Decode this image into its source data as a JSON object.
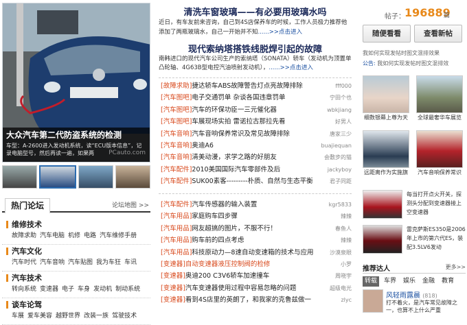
{
  "hero": {
    "title": "大众汽车第二代防盗系统的检测",
    "desc": "车型：A-2600进入发动机系统，读“ECU版本信息”，记录电脑型号，然后再读一遍，如果两",
    "watermark": "PCauto.com"
  },
  "forum": {
    "tab": "热门论坛",
    "more": "论坛地图 >>",
    "sections": [
      {
        "title": "维修技术",
        "links": [
          "故障求助",
          "汽车电脑",
          "机修",
          "电路",
          "汽车维修手册"
        ]
      },
      {
        "title": "汽车文化",
        "links": [
          "汽车时代",
          "汽车音响",
          "汽车贴图",
          "我为车狂",
          "车讯"
        ]
      },
      {
        "title": "汽车技术",
        "links": [
          "转向系统",
          "变速器",
          "电子",
          "车身",
          "发动机",
          "制动系统"
        ]
      },
      {
        "title": "谈车论驾",
        "links": [
          "车展",
          "爱车美容",
          "越野世界",
          "改装一族",
          "驾驶技术"
        ]
      }
    ]
  },
  "news1": {
    "title": "清洗车窗玻璃——有必要用玻璃水吗",
    "body": "近日，有车友前来咨询，自己到4S店保养车的时候，工作人员极力推荐他添加了两瓶玻璃水，自己一开始并不知",
    "more": "......>>点击进入"
  },
  "news2": {
    "title": "现代索纳塔搭铁线脱焊引起的故障",
    "body": "南韩进口的现代汽车公司生产的索纳塔（SONATA）轿车（发动机为顶置单凸轮轴、4G63B型电控汽油喷射发动机），",
    "more": "......>>点击进入"
  },
  "articles1": [
    {
      "cat": "[故障求助]",
      "title": "捷达轿车ABS故障警告灯点亮故障排除",
      "user": "fff000"
    },
    {
      "cat": "[汽车图吧]",
      "title": "电子交通罚单 杂谈各国违章罚单",
      "user": "宁田个也"
    },
    {
      "cat": "[汽车图吧]",
      "title": "汽车的环保功臣一三元催化器",
      "user": "wbkjiang"
    },
    {
      "cat": "[汽车图吧]",
      "title": "车展现场实拍 雷诺拉古那拉先看",
      "user": "好男人"
    },
    {
      "cat": "[汽车音响]",
      "title": "汽车音响保养常识及常见故障排除",
      "user": "唐家三少"
    },
    {
      "cat": "[汽车音响]",
      "title": "奥迪A6",
      "user": "buajiequan"
    },
    {
      "cat": "[汽车音响]",
      "title": "清美动漫，求学之路的好朋友",
      "user": "会敷步的猫"
    },
    {
      "cat": "[汽车配件]",
      "title": "2010美国国际汽车零部件及后",
      "user": "jackyboy"
    },
    {
      "cat": "[汽车配件]",
      "title": "SUK00素客---------朴质、自然与生态平衡",
      "user": "君子同距"
    }
  ],
  "articles2": [
    {
      "cat": "[汽车配件]",
      "title": "汽车传感器的输入装置",
      "user": "kgr5833"
    },
    {
      "cat": "[汽车用品]",
      "title": "家庭购车四步骤",
      "user": "辣辣"
    },
    {
      "cat": "[汽车用品]",
      "title": "网友超搞的图片，不服不行！",
      "user": "春鱼人"
    },
    {
      "cat": "[汽车用品]",
      "title": "购车前的四点考虑",
      "user": "辣辣"
    },
    {
      "cat": "[汽车用品]",
      "title": "科技原动力—8速自动变速箱的技术与应用",
      "user": "沙漠泉眼"
    },
    {
      "cat": "[变速器]",
      "title": "自动变速器液压控制阀的检修",
      "user": "小罗",
      "highlight": true
    },
    {
      "cat": "[变速器]",
      "title": "奥迪200 C3V6轿车加速撞车",
      "user": "周晓宇"
    },
    {
      "cat": "[变速器]",
      "title": "汽车变速器使用过程中容易忽略的问题",
      "user": "超级电光"
    },
    {
      "cat": "[变速器]",
      "title": "看到4S店里的英朗了，和我家的克鲁兹做一",
      "user": "zlyc"
    }
  ],
  "right": {
    "count_label": "帖子：",
    "count": "196889",
    "count_unit": "篇",
    "btn_random": "随便看看",
    "btn_new": "查看新帖",
    "notice1": "我如何实现发帖时图文混排效果",
    "notice_tag": "公告:",
    "notice2": "我如何实现发帖时图文混排效",
    "pics": [
      {
        "cap": "细数银幕上尊为天"
      },
      {
        "cap": "全球最奢华车展览"
      },
      {
        "cap": "远距离作为实施旗"
      },
      {
        "cap": "汽车音响保养常识"
      }
    ],
    "cars": [
      {
        "text": "每当打开点火开关，探测头分配到变速器接上空变速器"
      },
      {
        "text": "雷克萨斯ES350是2006年上市的第六代ES，装配3.5LV6发动"
      }
    ],
    "recom_title": "推荐达人",
    "recom_more": "更多>>",
    "tabs": [
      "转载",
      "车界",
      "娱乐",
      "金融",
      "教育"
    ],
    "user": {
      "name": "风轻雨露晨",
      "count": "(818)",
      "text": "打不着火，是汽车常见故障之一，也算不上什么严重"
    }
  }
}
